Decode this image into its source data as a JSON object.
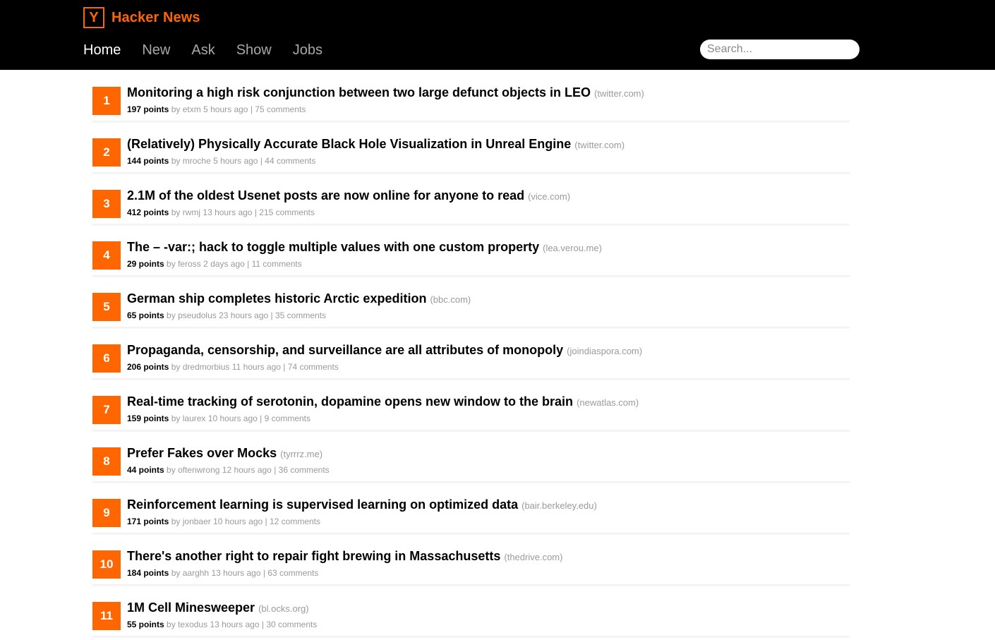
{
  "header": {
    "logo_letter": "Y",
    "title": "Hacker News",
    "accent_color": "#ff6600",
    "nav": [
      {
        "label": "Home",
        "active": true
      },
      {
        "label": "New",
        "active": false
      },
      {
        "label": "Ask",
        "active": false
      },
      {
        "label": "Show",
        "active": false
      },
      {
        "label": "Jobs",
        "active": false
      }
    ],
    "search": {
      "placeholder": "Search...",
      "value": ""
    }
  },
  "stories": [
    {
      "rank": "1",
      "title": "Monitoring a high risk conjunction between two large defunct objects in LEO",
      "domain": "(twitter.com)",
      "points": "197 points",
      "by": "by",
      "user": "etxm",
      "age": "5 hours ago",
      "sep": "|",
      "comments": "75 comments"
    },
    {
      "rank": "2",
      "title": "(Relatively) Physically Accurate Black Hole Visualization in Unreal Engine",
      "domain": "(twitter.com)",
      "points": "144 points",
      "by": "by",
      "user": "mroche",
      "age": "5 hours ago",
      "sep": "|",
      "comments": "44 comments"
    },
    {
      "rank": "3",
      "title": "2.1M of the oldest Usenet posts are now online for anyone to read",
      "domain": "(vice.com)",
      "points": "412 points",
      "by": "by",
      "user": "rwmj",
      "age": "13 hours ago",
      "sep": "|",
      "comments": "215 comments"
    },
    {
      "rank": "4",
      "title": "The – -var:; hack to toggle multiple values with one custom property",
      "domain": "(lea.verou.me)",
      "points": "29 points",
      "by": "by",
      "user": "feross",
      "age": "2 days ago",
      "sep": "|",
      "comments": "11 comments"
    },
    {
      "rank": "5",
      "title": "German ship completes historic Arctic expedition",
      "domain": "(bbc.com)",
      "points": "65 points",
      "by": "by",
      "user": "pseudolus",
      "age": "23 hours ago",
      "sep": "|",
      "comments": "35 comments"
    },
    {
      "rank": "6",
      "title": "Propaganda, censorship, and surveillance are all attributes of monopoly",
      "domain": "(joindiaspora.com)",
      "points": "206 points",
      "by": "by",
      "user": "dredmorbius",
      "age": "11 hours ago",
      "sep": "|",
      "comments": "74 comments"
    },
    {
      "rank": "7",
      "title": "Real-time tracking of serotonin, dopamine opens new window to the brain",
      "domain": "(newatlas.com)",
      "points": "159 points",
      "by": "by",
      "user": "laurex",
      "age": "10 hours ago",
      "sep": "|",
      "comments": "9 comments"
    },
    {
      "rank": "8",
      "title": "Prefer Fakes over Mocks",
      "domain": "(tyrrrz.me)",
      "points": "44 points",
      "by": "by",
      "user": "oftenwrong",
      "age": "12 hours ago",
      "sep": "|",
      "comments": "36 comments"
    },
    {
      "rank": "9",
      "title": "Reinforcement learning is supervised learning on optimized data",
      "domain": "(bair.berkeley.edu)",
      "points": "171 points",
      "by": "by",
      "user": "jonbaer",
      "age": "10 hours ago",
      "sep": "|",
      "comments": "12 comments"
    },
    {
      "rank": "10",
      "title": "There's another right to repair fight brewing in Massachusetts",
      "domain": "(thedrive.com)",
      "points": "184 points",
      "by": "by",
      "user": "aarghh",
      "age": "13 hours ago",
      "sep": "|",
      "comments": "63 comments"
    },
    {
      "rank": "11",
      "title": "1M Cell Minesweeper",
      "domain": "(bl.ocks.org)",
      "points": "55 points",
      "by": "by",
      "user": "texodus",
      "age": "13 hours ago",
      "sep": "|",
      "comments": "30 comments"
    }
  ]
}
